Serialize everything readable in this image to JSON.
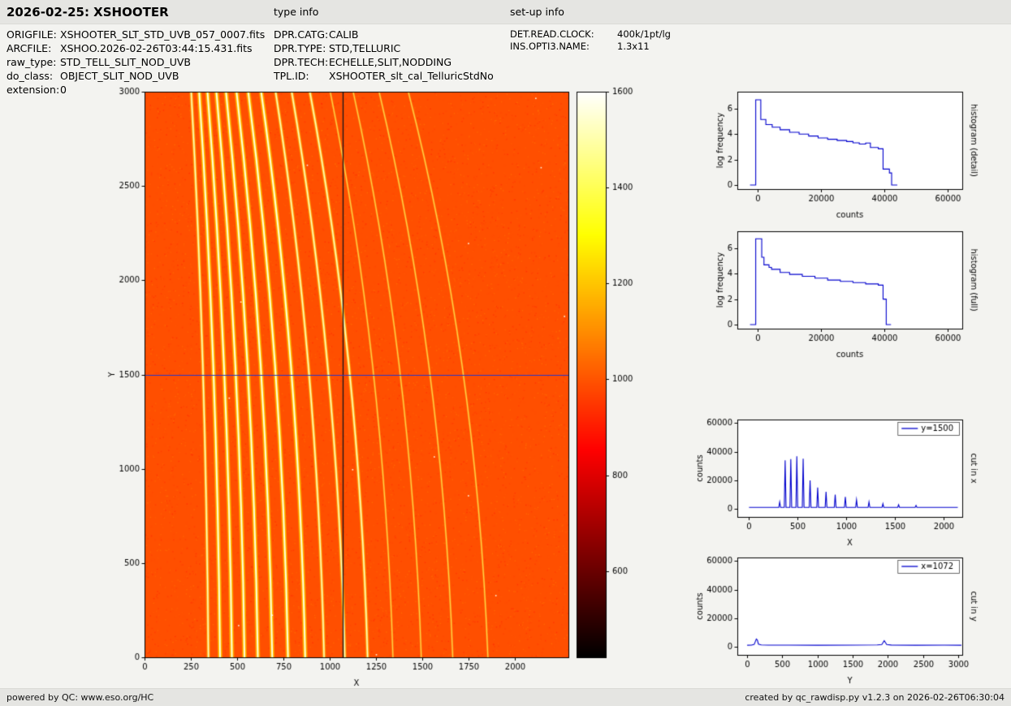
{
  "header": {
    "title": "2026-02-25: XSHOOTER",
    "type_info_label": "type info",
    "setup_info_label": "set-up info",
    "file_info": [
      {
        "label": "ORIGFILE:",
        "value": "XSHOOTER_SLT_STD_UVB_057_0007.fits"
      },
      {
        "label": "ARCFILE:",
        "value": "XSHOO.2026-02-26T03:44:15.431.fits"
      },
      {
        "label": "raw_type:",
        "value": "STD_TELL_SLIT_NOD_UVB"
      },
      {
        "label": "do_class:",
        "value": "OBJECT_SLIT_NOD_UVB"
      },
      {
        "label": "extension:",
        "value": "0"
      }
    ],
    "type_info": [
      {
        "label": "DPR.CATG:",
        "value": "CALIB"
      },
      {
        "label": "DPR.TYPE:",
        "value": "STD,TELLURIC"
      },
      {
        "label": "DPR.TECH:",
        "value": "ECHELLE,SLIT,NODDING"
      },
      {
        "label": "TPL.ID:",
        "value": "XSHOOTER_slt_cal_TelluricStdNo"
      }
    ],
    "setup_info": [
      {
        "label": "DET.READ.CLOCK:",
        "value": "400k/1pt/lg"
      },
      {
        "label": "INS.OPTI3.NAME:",
        "value": "1.3x11"
      }
    ]
  },
  "footer": {
    "left": "powered by QC: www.eso.org/HC",
    "right": "created by qc_rawdisp.py v1.2.3 on 2026-02-26T06:30:04"
  },
  "chart_data": [
    {
      "id": "raw-frame-image",
      "type": "heatmap",
      "xlabel": "X",
      "ylabel": "Y",
      "xlim": [
        0,
        2290
      ],
      "ylim": [
        0,
        3000
      ],
      "xticks": [
        0,
        250,
        500,
        750,
        1000,
        1250,
        1500,
        1750,
        2000
      ],
      "yticks": [
        0,
        500,
        1000,
        1500,
        2000,
        2500,
        3000
      ],
      "vmin": 420,
      "vmax": 1600,
      "background_level": 990,
      "cut_marker_x": 1072,
      "cut_marker_y": 1500,
      "cut_color_v": "#15151c",
      "cut_color_h": "#2a35c8",
      "orders": [
        {
          "bottom_x": 345,
          "top_x": 252,
          "intensity": 1
        },
        {
          "bottom_x": 408,
          "top_x": 295,
          "intensity": 2
        },
        {
          "bottom_x": 472,
          "top_x": 340,
          "intensity": 2
        },
        {
          "bottom_x": 540,
          "top_x": 388,
          "intensity": 2
        },
        {
          "bottom_x": 612,
          "top_x": 440,
          "intensity": 2
        },
        {
          "bottom_x": 690,
          "top_x": 497,
          "intensity": 2
        },
        {
          "bottom_x": 775,
          "top_x": 560,
          "intensity": 2
        },
        {
          "bottom_x": 868,
          "top_x": 630,
          "intensity": 2
        },
        {
          "bottom_x": 970,
          "top_x": 708,
          "intensity": 1
        },
        {
          "bottom_x": 1082,
          "top_x": 795,
          "intensity": 1
        },
        {
          "bottom_x": 1205,
          "top_x": 893,
          "intensity": 1
        },
        {
          "bottom_x": 1342,
          "top_x": 1003,
          "intensity": 0
        },
        {
          "bottom_x": 1495,
          "top_x": 1127,
          "intensity": 0
        },
        {
          "bottom_x": 1665,
          "top_x": 1267,
          "intensity": 0
        },
        {
          "bottom_x": 1855,
          "top_x": 1425,
          "intensity": 0
        }
      ]
    },
    {
      "id": "colorbar",
      "type": "colorbar",
      "colormap": "hot",
      "vmin": 420,
      "vmax": 1600,
      "ticks": [
        600,
        800,
        1000,
        1200,
        1400,
        1600
      ]
    },
    {
      "id": "histogram-detail",
      "type": "line",
      "xlabel": "counts",
      "ylabel": "log frequency",
      "right_label": "histogram (detail)",
      "xlim": [
        -6500,
        64500
      ],
      "ylim": [
        -0.32,
        7.34
      ],
      "xticks": [
        0,
        20000,
        40000,
        60000
      ],
      "yticks": [
        0,
        2,
        4,
        6
      ],
      "series": [
        {
          "name": "histogram (detail)",
          "color": "#0000cd",
          "x": [
            -2500,
            -700,
            -700,
            900,
            900,
            2500,
            2500,
            4500,
            4500,
            7000,
            7000,
            10000,
            10000,
            13000,
            13000,
            16000,
            16000,
            19000,
            19000,
            22000,
            22000,
            25000,
            25000,
            28000,
            28000,
            30000,
            30000,
            32000,
            32000,
            34000,
            34000,
            35500,
            35500,
            38000,
            38000,
            39500,
            39500,
            41500,
            41500,
            42200,
            42200,
            44000
          ],
          "y": [
            0,
            0,
            6.7,
            6.7,
            5.15,
            5.15,
            4.75,
            4.75,
            4.55,
            4.55,
            4.35,
            4.35,
            4.15,
            4.15,
            4.0,
            4.0,
            3.85,
            3.85,
            3.7,
            3.7,
            3.6,
            3.6,
            3.5,
            3.5,
            3.42,
            3.42,
            3.32,
            3.32,
            3.22,
            3.22,
            3.3,
            3.3,
            2.95,
            2.95,
            2.85,
            2.85,
            1.25,
            1.25,
            0.95,
            0.95,
            0,
            0
          ]
        }
      ]
    },
    {
      "id": "histogram-full",
      "type": "line",
      "xlabel": "counts",
      "ylabel": "log frequency",
      "right_label": "histogram (full)",
      "xlim": [
        -6500,
        64500
      ],
      "ylim": [
        -0.32,
        7.34
      ],
      "xticks": [
        0,
        20000,
        40000,
        60000
      ],
      "yticks": [
        0,
        2,
        4,
        6
      ],
      "series": [
        {
          "name": "histogram (full)",
          "color": "#0000cd",
          "x": [
            -2500,
            -700,
            -700,
            1200,
            1200,
            1900,
            1900,
            3500,
            3500,
            4300,
            4300,
            7000,
            7000,
            10000,
            10000,
            14000,
            14000,
            18000,
            18000,
            22000,
            22000,
            26000,
            26000,
            30000,
            30000,
            34000,
            34000,
            38000,
            38000,
            39500,
            39500,
            40500,
            40500,
            42000
          ],
          "y": [
            0,
            0,
            6.75,
            6.75,
            5.3,
            5.3,
            4.7,
            4.7,
            4.5,
            4.5,
            4.35,
            4.35,
            4.1,
            4.1,
            3.95,
            3.95,
            3.8,
            3.8,
            3.65,
            3.65,
            3.5,
            3.5,
            3.4,
            3.4,
            3.3,
            3.3,
            3.2,
            3.2,
            3.1,
            3.1,
            2.0,
            2.0,
            0,
            0
          ]
        }
      ]
    },
    {
      "id": "cut-in-x",
      "type": "line",
      "xlabel": "X",
      "ylabel": "counts",
      "right_label": "cut in x",
      "legend_label": "y=1500",
      "xlim": [
        -120,
        2190
      ],
      "ylim": [
        -5500,
        62500
      ],
      "xticks": [
        0,
        500,
        1000,
        1500,
        2000
      ],
      "yticks": [
        0,
        20000,
        40000,
        60000
      ],
      "series": [
        {
          "name": "y=1500",
          "color": "#0000cd",
          "x": [
            0,
            306,
            315,
            324,
            362,
            371,
            380,
            420,
            429,
            438,
            482,
            491,
            500,
            547,
            556,
            565,
            618,
            627,
            636,
            696,
            705,
            714,
            782,
            791,
            800,
            876,
            885,
            894,
            980,
            989,
            998,
            1095,
            1104,
            1113,
            1223,
            1232,
            1241,
            1366,
            1375,
            1384,
            1527,
            1536,
            1545,
            1706,
            1715,
            1724,
            2144
          ],
          "y": [
            1150,
            1150,
            5000,
            1150,
            1150,
            34000,
            1150,
            1150,
            34800,
            1150,
            1150,
            36800,
            1150,
            1150,
            35200,
            1150,
            1150,
            20000,
            1150,
            1150,
            15000,
            1150,
            1150,
            12000,
            1150,
            1150,
            10000,
            1150,
            1150,
            8500,
            1150,
            1150,
            6500,
            1150,
            1150,
            5000,
            1150,
            1150,
            3800,
            1150,
            1150,
            3000,
            1150,
            1150,
            2500,
            1150,
            1150
          ]
        }
      ]
    },
    {
      "id": "cut-in-y",
      "type": "line",
      "xlabel": "Y",
      "ylabel": "counts",
      "right_label": "cut in y",
      "legend_label": "x=1072",
      "xlim": [
        -140,
        3060
      ],
      "ylim": [
        -5500,
        62500
      ],
      "xticks": [
        0,
        500,
        1000,
        1500,
        2000,
        2500,
        3000
      ],
      "yticks": [
        0,
        20000,
        40000,
        60000
      ],
      "series": [
        {
          "name": "x=1072",
          "color": "#0000cd",
          "x": [
            0,
            60,
            100,
            130,
            145,
            160,
            200,
            300,
            600,
            1000,
            1500,
            1850,
            1915,
            1950,
            1985,
            2050,
            2400,
            2800,
            3048
          ],
          "y": [
            1250,
            1300,
            1800,
            5600,
            4800,
            2000,
            1400,
            1300,
            1300,
            1250,
            1300,
            1400,
            1700,
            4400,
            1700,
            1350,
            1250,
            1300,
            1250
          ]
        }
      ]
    }
  ]
}
